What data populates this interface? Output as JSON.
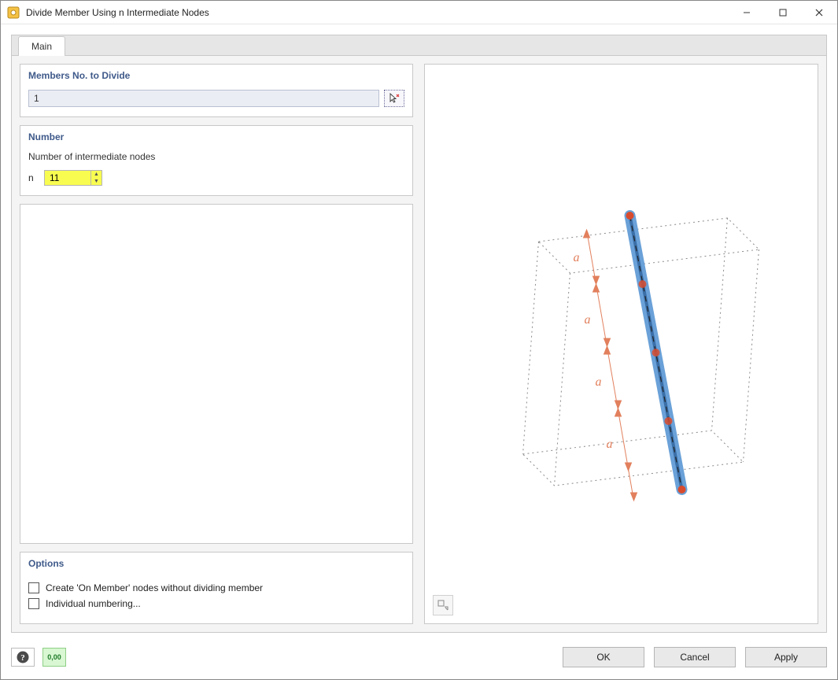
{
  "window": {
    "title": "Divide Member Using n Intermediate Nodes"
  },
  "tabs": {
    "main_label": "Main"
  },
  "members": {
    "header": "Members No. to Divide",
    "value": "1"
  },
  "number": {
    "header": "Number",
    "label": "Number of intermediate nodes",
    "prefix": "n",
    "value": "11"
  },
  "options": {
    "header": "Options",
    "create_on_member": "Create 'On Member' nodes without dividing member",
    "individual_numbering": "Individual numbering..."
  },
  "buttons": {
    "ok": "OK",
    "cancel": "Cancel",
    "apply": "Apply"
  },
  "preview": {
    "segment_labels": [
      "a",
      "a",
      "a",
      "a"
    ]
  },
  "icons": {
    "footer_units": "0,00"
  }
}
